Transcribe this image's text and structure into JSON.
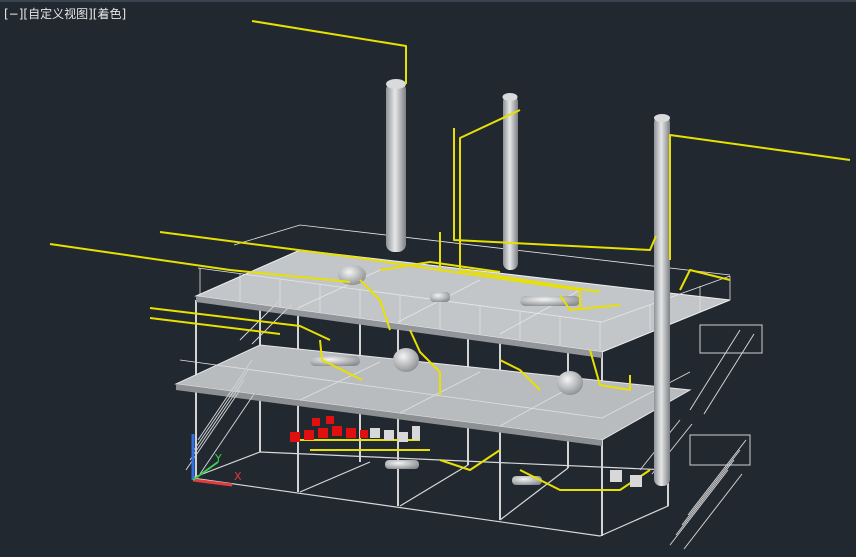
{
  "viewport": {
    "background": "#212830",
    "controls": {
      "viewport_menu": "[−]",
      "view_menu": "[自定义视图]",
      "visual_style_menu": "[着色]"
    }
  },
  "colors": {
    "pipe": "#e8e000",
    "steel": "#d2d2d2",
    "deck": "#b9bcbf",
    "column": "#c7c9cb",
    "valve": "#e01010",
    "axis_x": "#e23b3b",
    "axis_y": "#3bd04a",
    "axis_z": "#2f6fe0"
  },
  "axis_icon": {
    "x_label": "X",
    "y_label": "Y"
  },
  "model": {
    "description_visible": false,
    "towers": 3,
    "platform_levels": 2
  }
}
